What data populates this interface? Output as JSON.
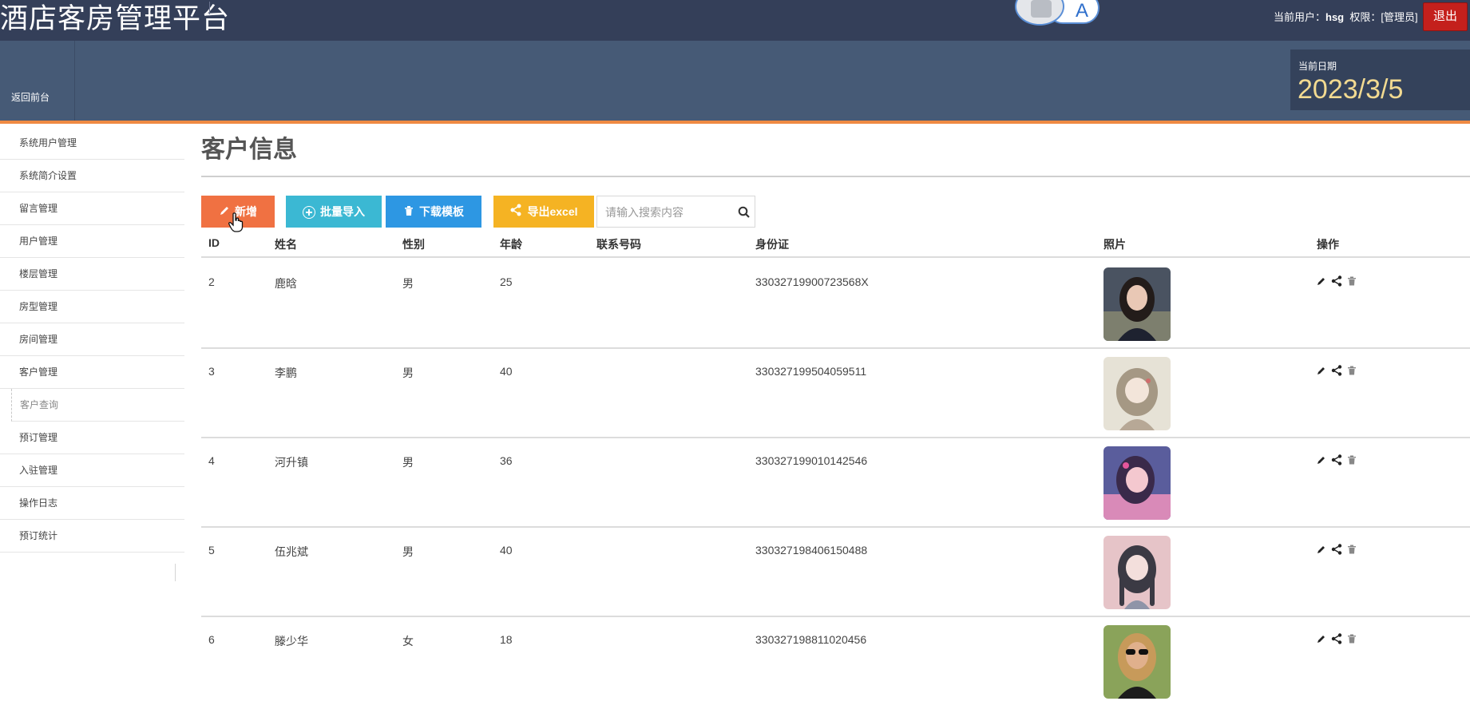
{
  "app": {
    "title": "酒店客房管理平台",
    "user_label": "当前用户：",
    "user_name": "hsg",
    "role_label": "权限：",
    "role_value": "[管理员]",
    "logout": "退出",
    "toggle_letter": "A"
  },
  "band": {
    "back_front": "返回前台",
    "date_label": "当前日期",
    "date_value": "2023/3/5"
  },
  "sidebar": {
    "items": [
      {
        "label": "系统用户管理"
      },
      {
        "label": "系统简介设置"
      },
      {
        "label": "留言管理"
      },
      {
        "label": "用户管理"
      },
      {
        "label": "楼层管理"
      },
      {
        "label": "房型管理"
      },
      {
        "label": "房间管理"
      },
      {
        "label": "客户管理"
      },
      {
        "label": "客户查询"
      },
      {
        "label": "预订管理"
      },
      {
        "label": "入驻管理"
      },
      {
        "label": "操作日志"
      },
      {
        "label": "预订统计"
      }
    ]
  },
  "main": {
    "title": "客户信息",
    "toolbar": {
      "add": "新增",
      "import": "批量导入",
      "template": "下载模板",
      "export": "导出excel",
      "search_placeholder": "请输入搜索内容"
    },
    "columns": [
      "ID",
      "姓名",
      "性别",
      "年龄",
      "联系号码",
      "身份证",
      "照片",
      "操作"
    ],
    "rows": [
      {
        "id": "2",
        "name": "鹿晗",
        "gender": "男",
        "age": "25",
        "phone": "",
        "idcard": "33032719900723568X",
        "photo": "photo-portrait-girl-dark-hair"
      },
      {
        "id": "3",
        "name": "李鹏",
        "gender": "男",
        "age": "40",
        "phone": "",
        "idcard": "330327199504059511",
        "photo": "photo-illustrated-girl"
      },
      {
        "id": "4",
        "name": "河升镇",
        "gender": "男",
        "age": "36",
        "phone": "",
        "idcard": "330327199010142546",
        "photo": "photo-illustrated-pink-girl"
      },
      {
        "id": "5",
        "name": "伍兆斌",
        "gender": "男",
        "age": "40",
        "phone": "",
        "idcard": "330327198406150488",
        "photo": "photo-illustrated-braids-girl"
      },
      {
        "id": "6",
        "name": "滕少华",
        "gender": "女",
        "age": "18",
        "phone": "",
        "idcard": "330327198811020456",
        "photo": "photo-woman-sunglasses"
      }
    ]
  },
  "colors": {
    "topbar": "#343f59",
    "band": "#465a76",
    "accent_orange": "#ef8a43",
    "logout": "#c4201c",
    "btn_add": "#f07142",
    "btn_import": "#3bb8d3",
    "btn_template": "#2d97e3",
    "btn_export": "#f5b323",
    "date": "#f2da91"
  }
}
